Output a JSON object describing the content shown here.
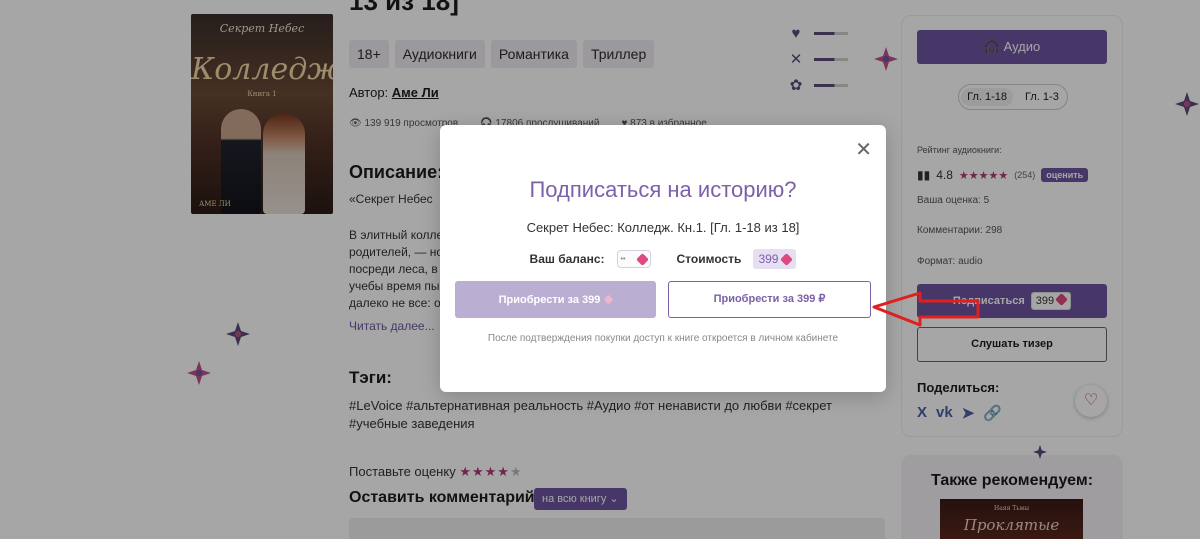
{
  "book": {
    "title_top": "13 из 18]",
    "cover": {
      "top_text": "Секрет Небес",
      "title": "Колледж",
      "subtitle": "Книга 1",
      "author": "АМЕ ЛИ"
    },
    "tags": [
      "18+",
      "Аудиокниги",
      "Романтика",
      "Триллер"
    ],
    "author_label": "Автор:",
    "author_name": "Аме Ли",
    "stats": [
      "139 919 просмотров",
      "17806 прослушиваний",
      "873 в избранное"
    ],
    "description_title": "Описание:",
    "description_p1": "«Секрет Небес",
    "description_p2": "В элитный колле родителей, — но посреди леса, в учебы время пы далеко не все: о",
    "read_more": "Читать далее...",
    "tags_title": "Тэги:",
    "tags_text": "#LeVoice #альтернативная реальность #Аудио #от ненависти до любви #секрет #учебные заведения",
    "rate_label": "Поставьте оценку",
    "rate_stars_on": "★★★★",
    "rate_stars_off": "★",
    "comment_title": "Оставить комментарий",
    "comment_select": "на всю книгу ⌄"
  },
  "sidebar": {
    "audio_button": "Аудио",
    "chapters": [
      "Гл. 1-18",
      "Гл. 1-3"
    ],
    "rating_label": "Рейтинг аудиокниги:",
    "rating_value": "4.8",
    "rating_stars": "★★★★★",
    "rating_count": "(254)",
    "rate_button": "оценить",
    "your_rating": "Ваша оценка: 5",
    "comments": "Комментарии: 298",
    "format": "Формат: audio",
    "subscribe_button": "Подписаться",
    "subscribe_price": "399",
    "teaser_button": "Слушать тизер",
    "share_label": "Поделиться:",
    "share_icons": [
      "X",
      "VK",
      "TG",
      "LINK"
    ],
    "recommend_title": "Также рекомендуем:",
    "reco_cover_top": "Наяя Тьмы",
    "reco_cover_title": "Проклятые"
  },
  "modal": {
    "title": "Подписаться на историю?",
    "subtitle": "Секрет Небес: Колледж. Кн.1. [Гл. 1-18 из 18]",
    "balance_label": "Ваш баланс:",
    "cost_label": "Стоимость",
    "cost_value": "399",
    "buy_gems_button": "Приобрести за 399",
    "buy_rub_button": "Приобрести за 399 ₽",
    "note": "После подтверждения покупки доступ к книге откроется в личном кабинете",
    "close_symbol": "✕"
  },
  "colors": {
    "accent": "#6d55a0",
    "modal_title": "#7d61a8",
    "gem": "#e0487f",
    "arrow": "#e01f1f"
  }
}
